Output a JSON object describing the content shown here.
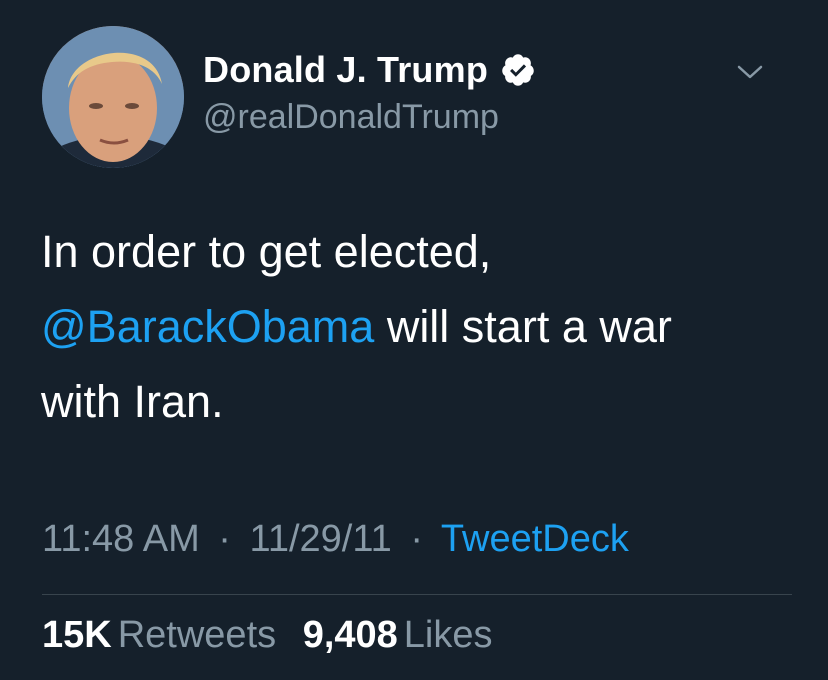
{
  "author": {
    "display_name": "Donald J. Trump",
    "handle": "@realDonaldTrump",
    "verified": true
  },
  "tweet": {
    "line1": "In order to get elected,",
    "mention": "@BarackObama",
    "line2_rest": " will start a war",
    "line3": "with Iran."
  },
  "meta": {
    "time": "11:48 AM",
    "separator": "·",
    "date": "11/29/11",
    "source": "TweetDeck"
  },
  "stats": {
    "retweets_count": "15K",
    "retweets_label": "Retweets",
    "likes_count": "9,408",
    "likes_label": "Likes"
  },
  "icons": {
    "verified": "verified-badge-icon",
    "caret": "chevron-down-icon"
  },
  "colors": {
    "background": "#15202b",
    "accent": "#1da1f2",
    "secondary_text": "#8899a6",
    "divider": "#38444d"
  }
}
